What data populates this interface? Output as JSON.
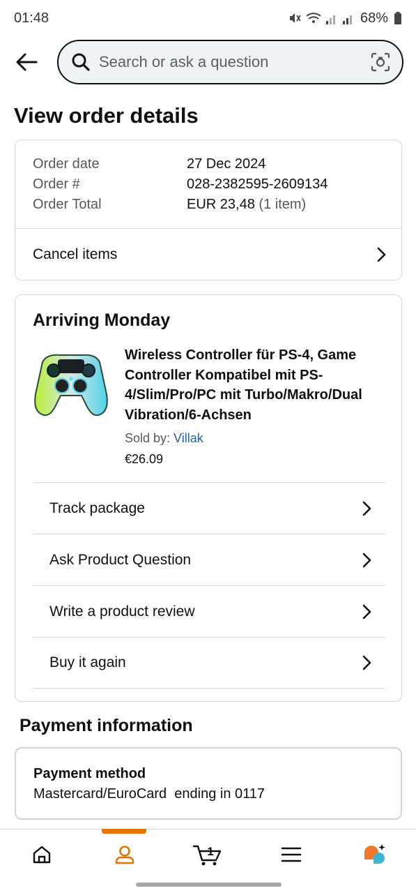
{
  "status_bar": {
    "time": "01:48",
    "battery": "68%"
  },
  "search": {
    "placeholder": "Search or ask a question"
  },
  "page": {
    "title": "View order details"
  },
  "order": {
    "date_label": "Order date",
    "date_value": "27 Dec 2024",
    "number_label": "Order #",
    "number_value": "028-2382595-2609134",
    "total_label": "Order Total",
    "total_value": "EUR 23,48",
    "total_items": "(1 item)",
    "cancel_label": "Cancel items"
  },
  "shipment": {
    "arrival": "Arriving Monday",
    "product_title": "Wireless Controller für PS-4, Game Controller Kompatibel mit PS-4/Slim/Pro/PC mit Turbo/Makro/Dual Vibration/6-Achsen",
    "sold_by_label": "Sold by: ",
    "seller": "Villak",
    "price": "€26.09",
    "actions": [
      {
        "label": "Track package"
      },
      {
        "label": "Ask Product Question"
      },
      {
        "label": "Write a product review"
      },
      {
        "label": "Buy it again"
      }
    ]
  },
  "payment": {
    "section_title": "Payment information",
    "method_label": "Payment method",
    "method_value": "Mastercard/EuroCard  ending in 0117"
  },
  "bottom_nav": {
    "cart_count": "1",
    "active": "account",
    "accent_color": "#e77600"
  }
}
